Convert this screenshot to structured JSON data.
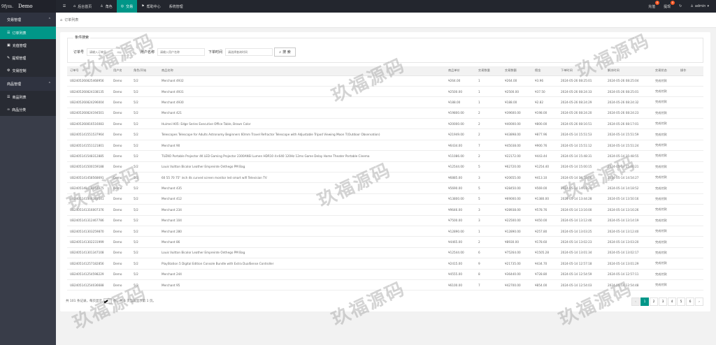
{
  "brand": {
    "text": "Demo",
    "prefix": "9fym."
  },
  "topnav": [
    {
      "label": "后台首页",
      "icon": "home-icon"
    },
    {
      "label": "角色",
      "icon": "user-icon"
    },
    {
      "label": "交易",
      "icon": "globe-icon",
      "active": true
    },
    {
      "label": "帮助中心",
      "icon": "flag-icon"
    },
    {
      "label": "系统管理",
      "icon": ""
    }
  ],
  "topright": {
    "recharge": {
      "label": "充值",
      "badge": "0"
    },
    "withdraw": {
      "label": "提现",
      "badge": "0"
    },
    "admin": "admin"
  },
  "sidebar": {
    "group1": "交易管理",
    "items1": [
      {
        "label": "订单列表",
        "active": true
      },
      {
        "label": "充值管理"
      },
      {
        "label": "提现管理"
      },
      {
        "label": "交易控制"
      }
    ],
    "group2": "商品管理",
    "items2": [
      {
        "label": "商品列表"
      },
      {
        "label": "商品分类"
      }
    ]
  },
  "breadcrumb": "订单列表",
  "search": {
    "legend": "条件搜索",
    "order_label": "订单号",
    "order_placeholder": "请输入订单号",
    "user_label": "用户名称",
    "user_placeholder": "请输入用户名称",
    "time_label": "下单时间",
    "time_placeholder": "请选择查询时间",
    "button": "搜 索"
  },
  "table": {
    "headers": [
      "订单号",
      "用户名",
      "角色/开始",
      "商品名称",
      "商品单价",
      "交易数量",
      "交易数额",
      "佣金",
      "下单时间",
      "解冻时间",
      "交易状态",
      "操作"
    ],
    "rows": [
      [
        "UB2405260825468956",
        "Demo",
        "5/2",
        "Merchant 4932",
        "¥264.00",
        "1",
        "¥264.00",
        "¥3.96",
        "2024-05-26 08:25:01",
        "2024-05-26 08:25:04",
        "完成付款",
        ""
      ],
      [
        "UB2405260824338135",
        "Demo",
        "5/2",
        "Merchant 4931",
        "¥2500.00",
        "1",
        "¥2500.00",
        "¥37.50",
        "2024-05-26 08:24:33",
        "2024-05-26 08:25:01",
        "完成付款",
        ""
      ],
      [
        "UB2405260824296004",
        "Demo",
        "5/2",
        "Merchant 4930",
        "¥188.00",
        "1",
        "¥188.00",
        "¥2.82",
        "2024-05-26 08:24:29",
        "2024-05-26 08:24:32",
        "完成付款",
        ""
      ],
      [
        "UB2405260824194501",
        "Demo",
        "5/2",
        "Merchant 421",
        "¥19800.00",
        "2",
        "¥39600.00",
        "¥198.00",
        "2024-05-26 08:24:20",
        "2024-05-26 08:24:23",
        "完成付款",
        ""
      ],
      [
        "UB2405260816516083",
        "Demo",
        "5/2",
        "Huimei H05: Edge Series Executive Office Table, Brown Color",
        "¥20000.00",
        "2",
        "¥40000.00",
        "¥800.00",
        "2024-05-26 08:16:51",
        "2024-05-26 08:17:01",
        "完成付款",
        ""
      ],
      [
        "UB2405141551537964",
        "Demo",
        "5/2",
        "Telescopes Telescope for Adults Astronomy Beginners 60mm Travel Refractor Telescope with Adjustable Tripod Viewing Moon T(Outdoor Observation)",
        "¥21949.00",
        "2",
        "¥43898.00",
        "¥877.96",
        "2024-05-14 15:51:53",
        "2024-05-14 15:51:59",
        "完成付款",
        ""
      ],
      [
        "UB2405141551121801",
        "Demo",
        "5/2",
        "Merchant 90",
        "¥6434.00",
        "7",
        "¥45038.00",
        "¥900.76",
        "2024-05-14 15:51:12",
        "2024-05-14 15:51:24",
        "完成付款",
        ""
      ],
      [
        "UB2405141548312885",
        "Demo",
        "5/2",
        "TUZKO Portable Projector 4K LED Gaming Projector 2300ANSI Lumen HDR10 4×640 120Hz 12ms Game Delay Home Theater Portable Cinema",
        "¥11086.00",
        "2",
        "¥22172.00",
        "¥443.44",
        "2024-05-14 15:48:31",
        "2024-05-14 15:48:55",
        "完成付款",
        ""
      ],
      [
        "UB2405141500159188",
        "Demo",
        "5/2",
        "Louis Vuitton Bicolor Leather Empreinte Onthego PM Bag",
        "¥12544.00",
        "5",
        "¥62720.00",
        "¥1254.40",
        "2024-05-14 15:00:15",
        "2024-05-14 15:00:21",
        "完成付款",
        ""
      ],
      [
        "UB2405141458568691",
        "Demo",
        "5/2",
        "60 55 70 75\" inch 4k curved screen monitor led smart wifi Television TV",
        "¥6885.00",
        "3",
        "¥20655.00",
        "¥413.10",
        "2024-05-14 14:58:56",
        "2024-05-14 14:54:27",
        "完成付款",
        ""
      ],
      [
        "UB2405141418244175",
        "Demo",
        "5/2",
        "Merchant 435",
        "¥5690.00",
        "5",
        "¥28450.00",
        "¥569.00",
        "2024-05-14 14:18:24",
        "2024-05-14 14:18:52",
        "完成付款",
        ""
      ],
      [
        "UB2405141344383541",
        "Demo",
        "5/2",
        "Merchant 412",
        "¥13800.00",
        "5",
        "¥69000.00",
        "¥1380.00",
        "2024-05-14 13:44:28",
        "2024-05-14 13:50:16",
        "完成付款",
        ""
      ],
      [
        "UB2405141316007376",
        "Demo",
        "5/2",
        "Merchant 234",
        "¥9646.00",
        "3",
        "¥28938.00",
        "¥578.76",
        "2024-05-14 13:16:00",
        "2024-05-14 13:16:26",
        "完成付款",
        ""
      ],
      [
        "UB2405141312467786",
        "Demo",
        "5/2",
        "Merchant 104",
        "¥7500.00",
        "3",
        "¥22500.00",
        "¥450.00",
        "2024-05-14 13:12:46",
        "2024-05-14 13:14:19",
        "完成付款",
        ""
      ],
      [
        "UB2405141303259870",
        "Demo",
        "5/2",
        "Merchant 280",
        "¥12890.00",
        "1",
        "¥12890.00",
        "¥257.80",
        "2024-05-14 13:03:25",
        "2024-05-14 13:12:40",
        "完成付款",
        ""
      ],
      [
        "UB2405141302231999",
        "Demo",
        "5/2",
        "Merchant 86",
        "¥4465.00",
        "2",
        "¥8930.00",
        "¥178.60",
        "2024-05-14 13:02:23",
        "2024-05-14 13:03:20",
        "完成付款",
        ""
      ],
      [
        "UB2405141301347108",
        "Demo",
        "5/2",
        "Louis Vuitton Bicolor Leather Empreinte Onthego PM Bag",
        "¥12544.00",
        "6",
        "¥75264.00",
        "¥1505.28",
        "2024-05-14 13:01:34",
        "2024-05-14 13:02:17",
        "完成付款",
        ""
      ],
      [
        "UB2405141257182856",
        "Demo",
        "5/2",
        "PlayStation 5 Digital Edition Console Bundle with Extra DualSense Controller",
        "¥2415.00",
        "9",
        "¥21735.00",
        "¥434.70",
        "2024-05-14 12:57:18",
        "2024-05-14 13:01:29",
        "完成付款",
        ""
      ],
      [
        "UB2405141254598229",
        "Demo",
        "5/2",
        "Merchant 244",
        "¥4555.00",
        "8",
        "¥36440.00",
        "¥728.80",
        "2024-05-14 12:54:59",
        "2024-05-14 12:57:11",
        "完成付款",
        ""
      ],
      [
        "UB2405141254036688",
        "Demo",
        "5/2",
        "Merchant 95",
        "¥6100.00",
        "7",
        "¥42700.00",
        "¥854.00",
        "2024-05-14 12:54:03",
        "2024-05-14 12:54:48",
        "完成付款",
        ""
      ]
    ]
  },
  "pagination": {
    "info_prefix": "共 101 条记录，每页显示",
    "page_size": "20",
    "info_suffix": "条，共 6 页当前显示第 1 页。",
    "pages": [
      "‹",
      "1",
      "2",
      "3",
      "4",
      "5",
      "6",
      "›"
    ]
  },
  "watermark": "玖福源码"
}
